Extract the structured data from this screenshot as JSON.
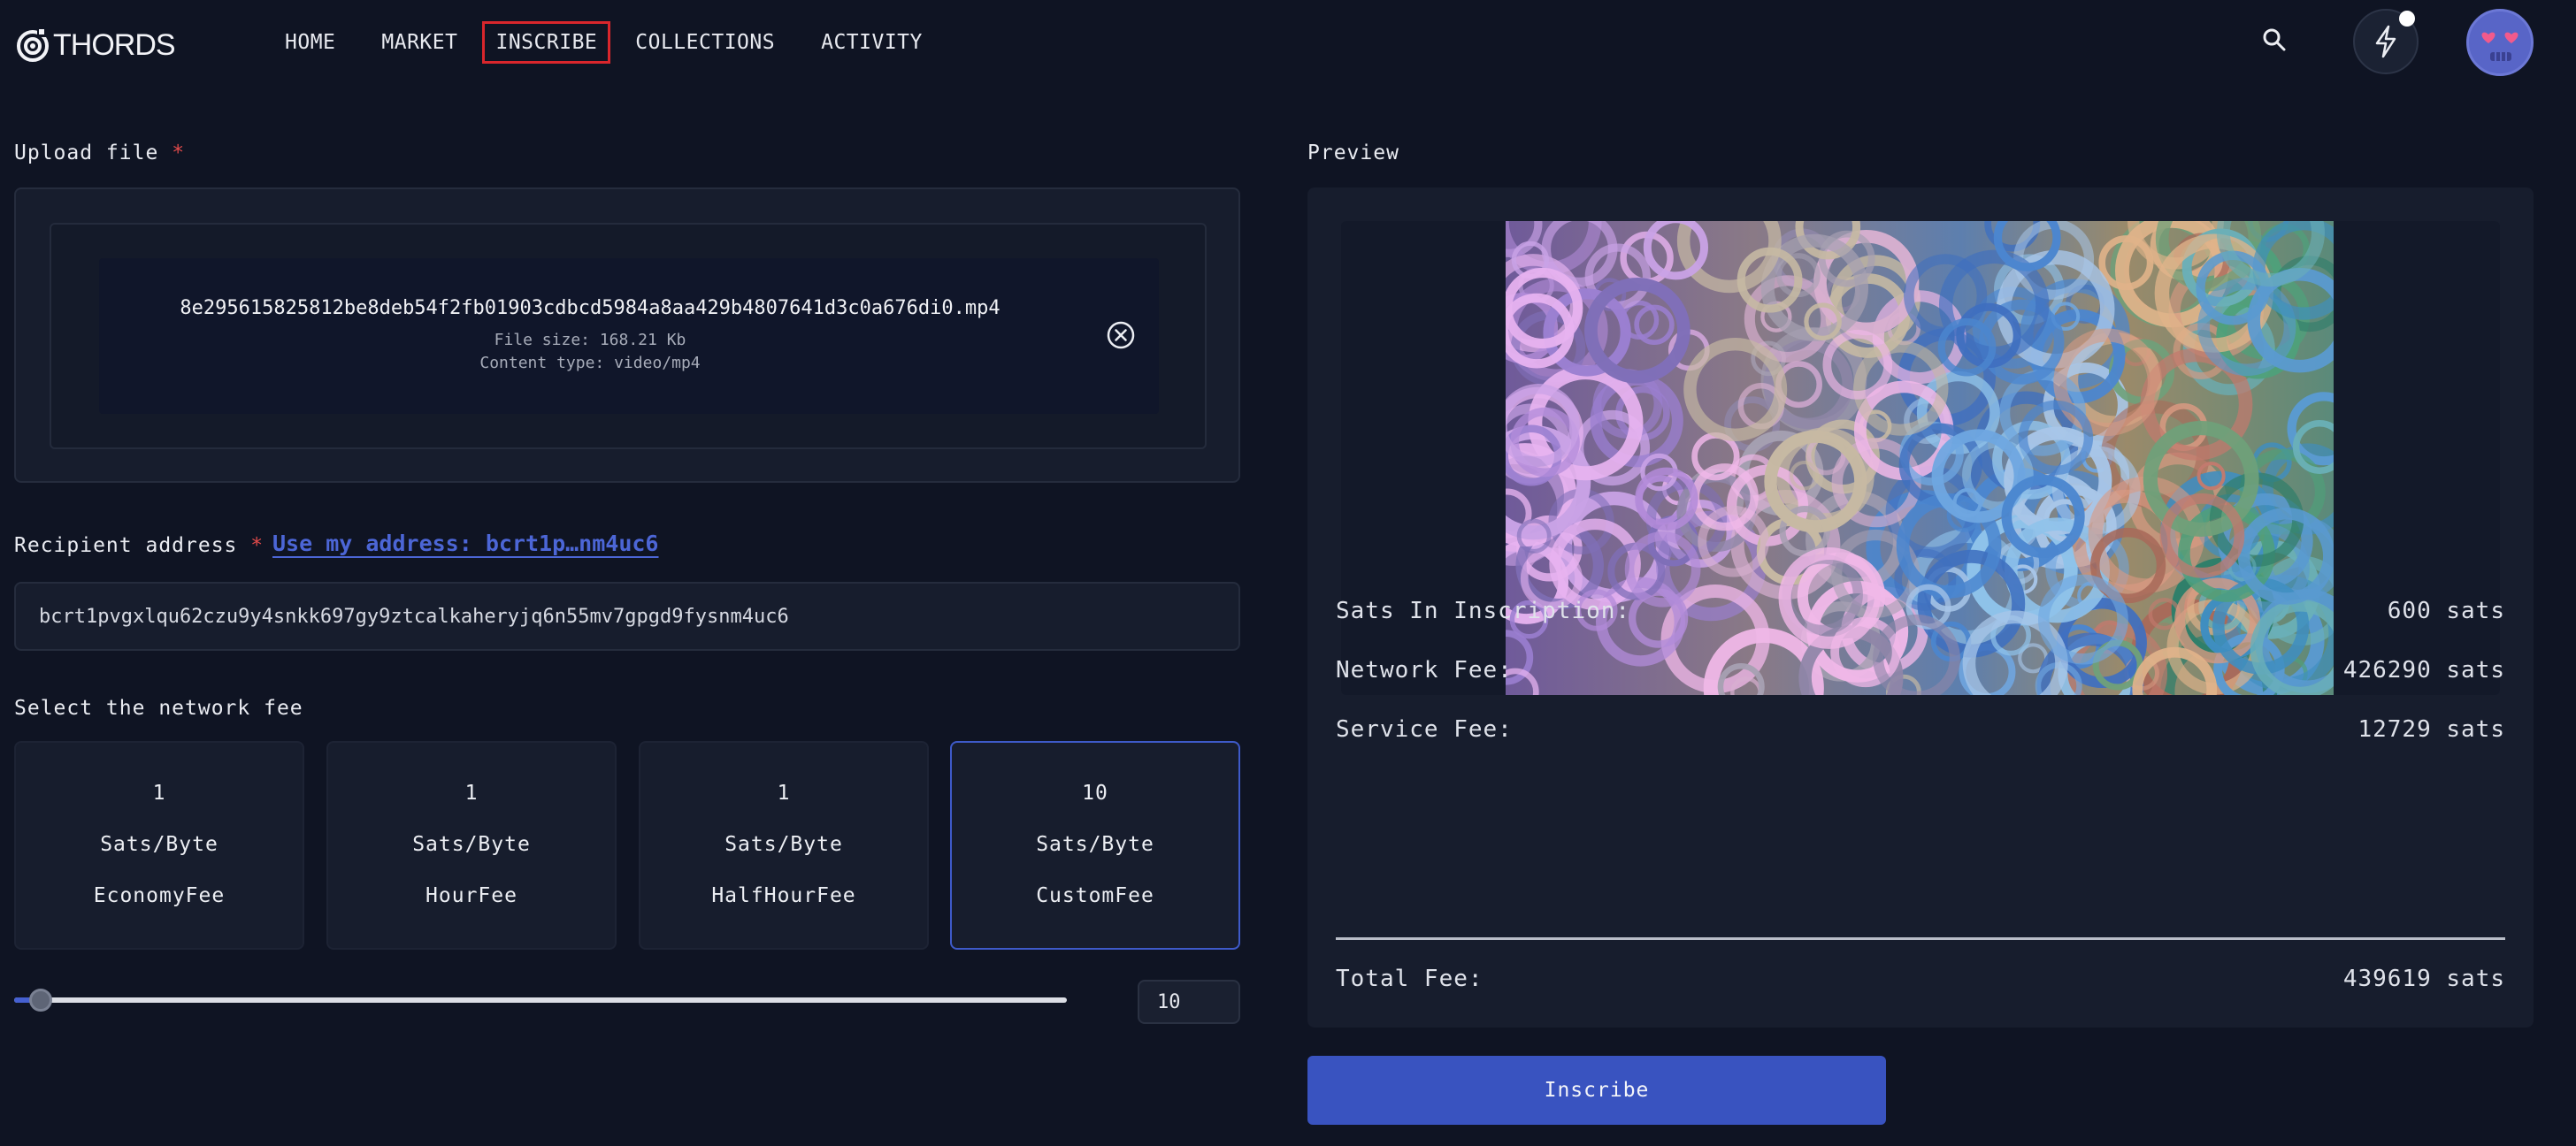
{
  "header": {
    "logo_text": "THORDS",
    "nav": [
      "HOME",
      "MARKET",
      "INSCRIBE",
      "COLLECTIONS",
      "ACTIVITY"
    ],
    "active_nav": "INSCRIBE"
  },
  "upload": {
    "label": "Upload file",
    "required_mark": "*",
    "file_name": "8e295615825812be8deb54f2fb01903cdbcd5984a8aa429b4807641d3c0a676di0.mp4",
    "file_size": "File size: 168.21 Kb",
    "content_type": "Content type: video/mp4"
  },
  "recipient": {
    "label": "Recipient address",
    "required_mark": "*",
    "use_my_address": "Use my address: bcrt1p…nm4uc6",
    "value": "bcrt1pvgxlqu62czu9y4snkk697gy9ztcalkaheryjq6n55mv7gpgd9fysnm4uc6"
  },
  "network_fee": {
    "label": "Select the network fee",
    "options": [
      {
        "rate": "1",
        "unit": "Sats/Byte",
        "name": "EconomyFee"
      },
      {
        "rate": "1",
        "unit": "Sats/Byte",
        "name": "HourFee"
      },
      {
        "rate": "1",
        "unit": "Sats/Byte",
        "name": "HalfHourFee"
      },
      {
        "rate": "10",
        "unit": "Sats/Byte",
        "name": "CustomFee"
      }
    ],
    "selected": "CustomFee",
    "slider_fraction": 0.025,
    "custom_value": "10"
  },
  "preview": {
    "label": "Preview",
    "rows": [
      {
        "key": "Sats In Inscription:",
        "value": "600 sats"
      },
      {
        "key": "Network Fee:",
        "value": "426290 sats"
      },
      {
        "key": "Service Fee:",
        "value": "12729 sats"
      }
    ],
    "total": {
      "key": "Total Fee:",
      "value": "439619 sats"
    }
  },
  "inscribe_button": "Inscribe",
  "colors": {
    "background": "#0f1423",
    "panel": "#171d2d",
    "accent": "#3953c0",
    "link": "#4c66d6",
    "required": "#e04a4a",
    "active_nav_border": "#d9262c"
  }
}
